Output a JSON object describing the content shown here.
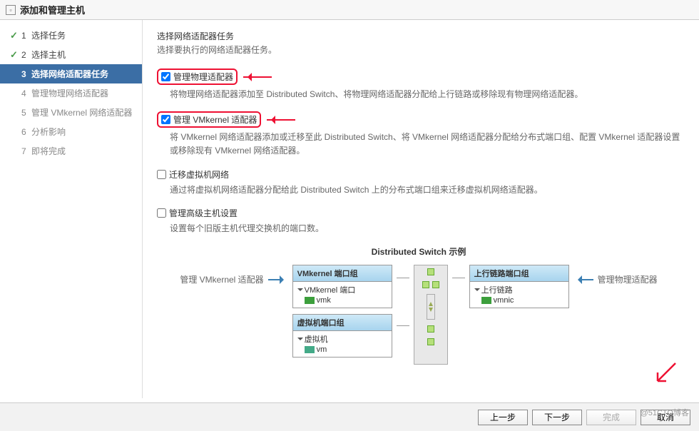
{
  "title": "添加和管理主机",
  "steps": [
    {
      "num": "1",
      "label": "选择任务",
      "state": "done"
    },
    {
      "num": "2",
      "label": "选择主机",
      "state": "done"
    },
    {
      "num": "3",
      "label": "选择网络适配器任务",
      "state": "active"
    },
    {
      "num": "4",
      "label": "管理物理网络适配器",
      "state": "pending"
    },
    {
      "num": "5",
      "label": "管理 VMkernel 网络适配器",
      "state": "pending"
    },
    {
      "num": "6",
      "label": "分析影响",
      "state": "pending"
    },
    {
      "num": "7",
      "label": "即将完成",
      "state": "pending"
    }
  ],
  "content": {
    "heading": "选择网络适配器任务",
    "subheading": "选择要执行的网络适配器任务。",
    "options": [
      {
        "label": "管理物理适配器",
        "checked": true,
        "highlight": true,
        "desc": "将物理网络适配器添加至 Distributed Switch、将物理网络适配器分配给上行链路或移除现有物理网络适配器。"
      },
      {
        "label": "管理 VMkernel 适配器",
        "checked": true,
        "highlight": true,
        "desc": "将 VMkernel 网络适配器添加或迁移至此 Distributed Switch、将 VMkernel 网络适配器分配给分布式端口组、配置 VMkernel 适配器设置或移除现有 VMkernel 网络适配器。"
      },
      {
        "label": "迁移虚拟机网络",
        "checked": false,
        "highlight": false,
        "desc": "通过将虚拟机网络适配器分配给此 Distributed Switch 上的分布式端口组来迁移虚拟机网络适配器。"
      },
      {
        "label": "管理高级主机设置",
        "checked": false,
        "highlight": false,
        "desc": "设置每个旧版主机代理交换机的端口数。"
      }
    ]
  },
  "diagram": {
    "title": "Distributed Switch 示例",
    "left_label": "管理 VMkernel 适配器",
    "right_label": "管理物理适配器",
    "pg1_header": "VMkernel 端口组",
    "pg1_row1": "VMkernel 端口",
    "pg1_row2": "vmk",
    "pg2_header": "虚拟机端口组",
    "pg2_row1": "虚拟机",
    "pg2_row2": "vm",
    "pg3_header": "上行链路端口组",
    "pg3_row1": "上行链路",
    "pg3_row2": "vmnic"
  },
  "buttons": {
    "back": "上一步",
    "next": "下一步",
    "finish": "完成",
    "cancel": "取消"
  },
  "watermark": "@51CTO博客"
}
